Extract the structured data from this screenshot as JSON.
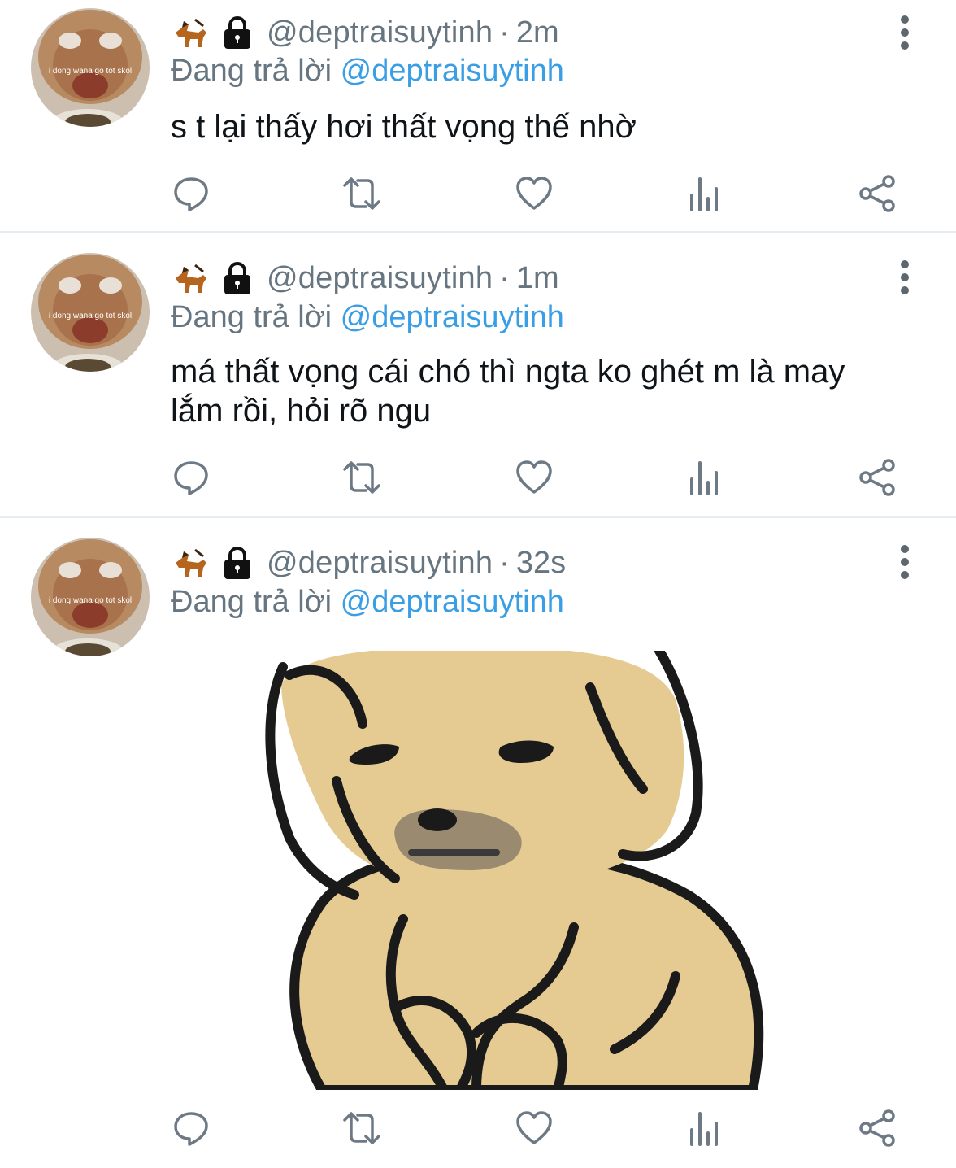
{
  "tweets": [
    {
      "handle": "@deptraisuytinh",
      "separator": "·",
      "time": "2m",
      "reply_prefix": "Đang trả lời",
      "reply_to": "@deptraisuytinh",
      "text": "s t lại thấy hơi thất vọng thế nhờ"
    },
    {
      "handle": "@deptraisuytinh",
      "separator": "·",
      "time": "1m",
      "reply_prefix": "Đang trả lời",
      "reply_to": "@deptraisuytinh",
      "text": "má thất vọng cái chó thì ngta ko ghét m là may lắm rồi, hỏi rõ ngu"
    },
    {
      "handle": "@deptraisuytinh",
      "separator": "·",
      "time": "32s",
      "reply_prefix": "Đang trả lời",
      "reply_to": "@deptraisuytinh",
      "text": ""
    }
  ],
  "avatar_caption": "i dong wana go tot skol",
  "icons": {
    "badge_1": "dog-emoji-icon",
    "badge_2": "lock-icon",
    "more": "more-vertical-icon",
    "reply": "reply-icon",
    "retweet": "retweet-icon",
    "like": "heart-icon",
    "analytics": "analytics-icon",
    "share": "share-icon"
  },
  "colors": {
    "text": "#0f1419",
    "secondary": "#66757f",
    "mention": "#3a9ee5",
    "icon": "#6d7a85",
    "divider": "#e6ecf0",
    "dog_fill": "#e5cb92"
  }
}
